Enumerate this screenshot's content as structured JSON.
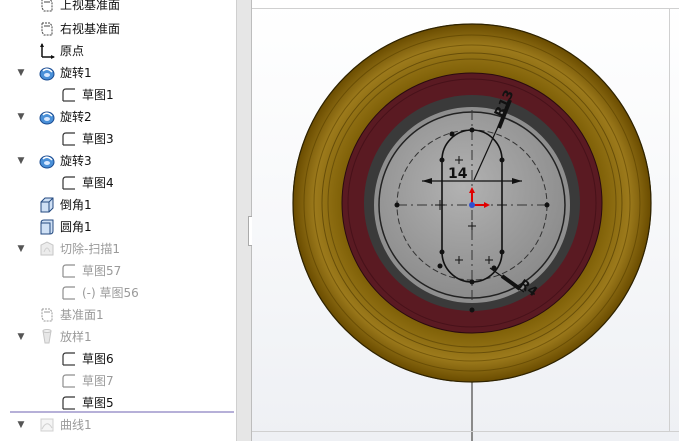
{
  "feature_tree": {
    "items": [
      {
        "label": "上视基准面",
        "icon": "plane-icon",
        "dim": false,
        "expand": ""
      },
      {
        "label": "右视基准面",
        "icon": "plane-icon",
        "dim": false,
        "expand": ""
      },
      {
        "label": "原点",
        "icon": "origin-icon",
        "dim": false,
        "expand": ""
      },
      {
        "label": "旋转1",
        "icon": "revolve-icon",
        "dim": false,
        "expand": "▼"
      },
      {
        "label": "草图1",
        "icon": "sketch-icon",
        "dim": false,
        "expand": ""
      },
      {
        "label": "旋转2",
        "icon": "revolve-icon",
        "dim": false,
        "expand": "▼"
      },
      {
        "label": "草图3",
        "icon": "sketch-icon",
        "dim": false,
        "expand": ""
      },
      {
        "label": "旋转3",
        "icon": "revolve-icon",
        "dim": false,
        "expand": "▼"
      },
      {
        "label": "草图4",
        "icon": "sketch-icon",
        "dim": false,
        "expand": ""
      },
      {
        "label": "倒角1",
        "icon": "chamfer-icon",
        "dim": false,
        "expand": ""
      },
      {
        "label": "圆角1",
        "icon": "fillet-icon",
        "dim": false,
        "expand": ""
      },
      {
        "label": "切除-扫描1",
        "icon": "sweep-cut-icon",
        "dim": true,
        "expand": "▼"
      },
      {
        "label": "草图57",
        "icon": "sketch-icon",
        "dim": true,
        "expand": ""
      },
      {
        "label": "(-) 草图56",
        "icon": "sketch-icon",
        "dim": true,
        "expand": ""
      },
      {
        "label": "基准面1",
        "icon": "plane-icon",
        "dim": true,
        "expand": ""
      },
      {
        "label": "放样1",
        "icon": "loft-icon",
        "dim": true,
        "expand": "▼"
      },
      {
        "label": "草图6",
        "icon": "sketch-icon",
        "dim": false,
        "expand": ""
      },
      {
        "label": "草图7",
        "icon": "sketch-icon",
        "dim": true,
        "expand": ""
      },
      {
        "label": "草图5",
        "icon": "sketch-icon",
        "dim": false,
        "expand": ""
      },
      {
        "label": "曲线1",
        "icon": "curve-icon",
        "dim": true,
        "expand": "▼"
      }
    ]
  },
  "viewport": {
    "dimension_width": "14",
    "dimension_radius_top": "R13",
    "dimension_radius_bottom": "R4"
  },
  "colors": {
    "outer_ring": "#8a6a0a",
    "outer_ring_dark": "#5e4500",
    "maroon_ring": "#5a1a22",
    "inner_disc": "#a6a6a6",
    "sketch_line": "#111111",
    "selection_line": "#b6b0d8"
  }
}
